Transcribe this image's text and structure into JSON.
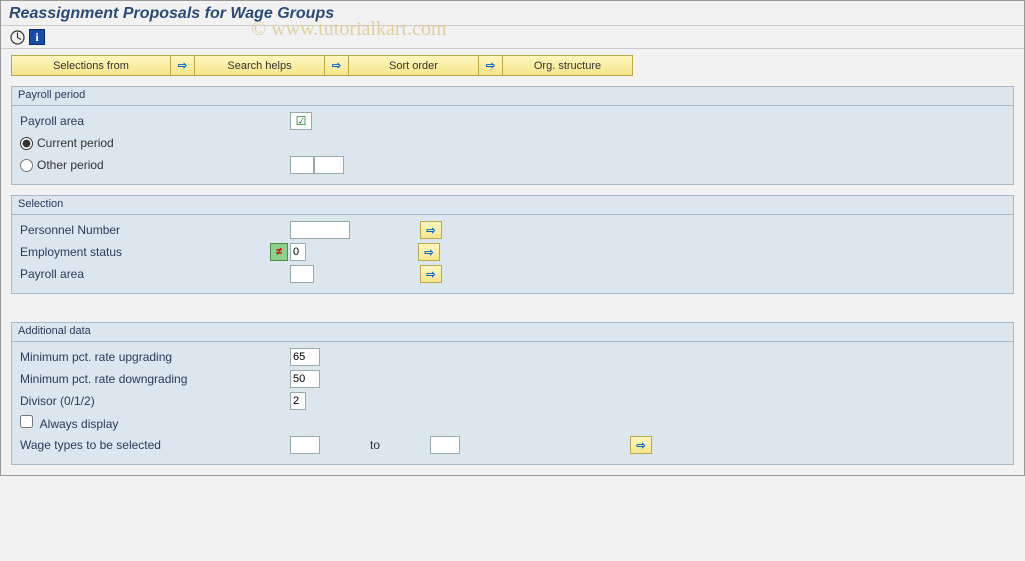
{
  "title": "Reassignment Proposals for Wage Groups",
  "watermark": "© www.tutorialkart.com",
  "toolbar_buttons": {
    "selections_from": "Selections from",
    "search_helps": "Search helps",
    "sort_order": "Sort order",
    "org_structure": "Org. structure"
  },
  "group_payroll": {
    "title": "Payroll period",
    "payroll_area_label": "Payroll area",
    "payroll_area_value": "",
    "current_period_label": "Current period",
    "current_period_selected": true,
    "other_period_label": "Other period",
    "other_period_selected": false,
    "other_period_value1": "",
    "other_period_value2": ""
  },
  "group_selection": {
    "title": "Selection",
    "personnel_number_label": "Personnel Number",
    "personnel_number_value": "",
    "employment_status_label": "Employment status",
    "employment_status_value": "0",
    "payroll_area_label": "Payroll area",
    "payroll_area_value": ""
  },
  "group_additional": {
    "title": "Additional data",
    "min_up_label": "Minimum pct. rate upgrading",
    "min_up_value": "65",
    "min_down_label": "Minimum pct. rate downgrading",
    "min_down_value": "50",
    "divisor_label": "Divisor (0/1/2)",
    "divisor_value": "2",
    "always_display_label": "Always display",
    "always_display_checked": false,
    "wage_types_label": "Wage types to be selected",
    "wage_types_from": "",
    "to_label": "to",
    "wage_types_to": ""
  }
}
